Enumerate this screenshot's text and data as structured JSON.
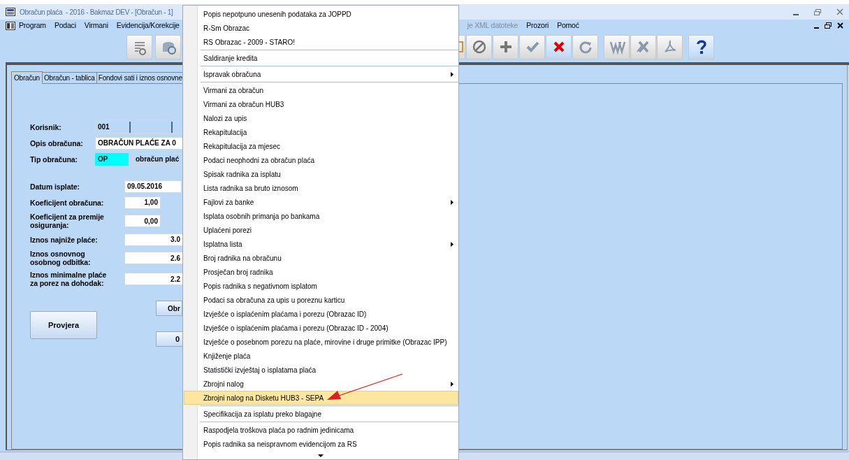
{
  "window": {
    "title": "Obračun plaća  - 2016 - Bakmaz DEV - [Obračun - 1]"
  },
  "menu_bar": [
    {
      "label": "Program",
      "disabled": false
    },
    {
      "label": "Podaci",
      "disabled": false
    },
    {
      "label": "Virmani",
      "disabled": false
    },
    {
      "label": "Evidencija/Korekcije",
      "disabled": false
    },
    {
      "label": "je XML datoteke",
      "disabled": true
    },
    {
      "label": "Prozori",
      "disabled": false
    },
    {
      "label": "Pomoć",
      "disabled": false
    }
  ],
  "tabs": [
    {
      "label": "Obračun",
      "selected": true
    },
    {
      "label": "Obračun - tablica",
      "selected": false
    },
    {
      "label": "Fondovi sati i iznos osnovne",
      "selected": false
    }
  ],
  "form": [
    {
      "label": "Korisnik:",
      "value": "001",
      "kind": "user"
    },
    {
      "label": "Opis obračuna:",
      "value": "OBRAČUN PLAĆE ZA 0",
      "kind": "wide"
    },
    {
      "label": "Tip obračuna:",
      "value": "OP",
      "extra": "obračun plać",
      "kind": "type"
    },
    {
      "label": "Datum isplate:",
      "value": "09.05.2016",
      "kind": "date"
    },
    {
      "label": "Koeficijent obračuna:",
      "value": "1,00",
      "kind": "small"
    },
    {
      "label": "Koeficijent za premije osiguranja:",
      "value": "0,00",
      "kind": "small"
    },
    {
      "label": "Iznos najniže plaće:",
      "value": "3.0",
      "kind": "amount"
    },
    {
      "label": "Iznos osnovnog osobnog odbitka:",
      "value": "2.6",
      "kind": "amount"
    },
    {
      "label": "Iznos minimalne plaće za porez na dohodak:",
      "value": "2.2",
      "kind": "amount"
    }
  ],
  "buttons": {
    "check": "Provjera",
    "calc": "Obr",
    "zero": "0"
  },
  "context_menu": [
    {
      "label": "Popis nepotpuno unesenih podataka za JOPPD",
      "submenu": false,
      "selected": false
    },
    {
      "label": "R-Sm Obrazac",
      "submenu": false,
      "selected": false
    },
    {
      "label": "RS Obrazac - 2009 - STARO!",
      "submenu": false,
      "selected": false,
      "separator_after": true
    },
    {
      "label": "Saldiranje kredita",
      "submenu": false,
      "selected": false,
      "separator_after": true
    },
    {
      "label": "Ispravak obračuna",
      "submenu": true,
      "selected": false,
      "separator_after": true
    },
    {
      "label": "Virmani za obračun",
      "submenu": false,
      "selected": false
    },
    {
      "label": "Virmani za obračun HUB3",
      "submenu": false,
      "selected": false
    },
    {
      "label": "Nalozi za upis",
      "submenu": false,
      "selected": false
    },
    {
      "label": "Rekapitulacija",
      "submenu": false,
      "selected": false
    },
    {
      "label": "Rekapitulacija za mjesec",
      "submenu": false,
      "selected": false
    },
    {
      "label": "Podaci neophodni za obračun plaća",
      "submenu": false,
      "selected": false
    },
    {
      "label": "Spisak radnika za isplatu",
      "submenu": false,
      "selected": false
    },
    {
      "label": "Lista radnika sa bruto iznosom",
      "submenu": false,
      "selected": false
    },
    {
      "label": "Fajlovi za banke",
      "submenu": true,
      "selected": false
    },
    {
      "label": "Isplata osobnih primanja po bankama",
      "submenu": false,
      "selected": false
    },
    {
      "label": "Uplaćeni porezi",
      "submenu": false,
      "selected": false
    },
    {
      "label": "Isplatna lista",
      "submenu": true,
      "selected": false
    },
    {
      "label": "Broj radnika na obračunu",
      "submenu": false,
      "selected": false
    },
    {
      "label": "Prosječan broj radnika",
      "submenu": false,
      "selected": false
    },
    {
      "label": "Popis radnika s negativnom isplatom",
      "submenu": false,
      "selected": false
    },
    {
      "label": "Podaci sa obračuna za upis u poreznu karticu",
      "submenu": false,
      "selected": false
    },
    {
      "label": "Izvješće o isplaćenim plaćama i porezu (Obrazac ID)",
      "submenu": false,
      "selected": false
    },
    {
      "label": "Izvješće o isplaćenim plaćama i porezu (Obrazac ID - 2004)",
      "submenu": false,
      "selected": false
    },
    {
      "label": "Izvješće o posebnom porezu na plaće, mirovine i druge primitke (Obrazac IPP)",
      "submenu": false,
      "selected": false
    },
    {
      "label": "Knjiženje plaća",
      "submenu": false,
      "selected": false
    },
    {
      "label": "Statistički izvještaj o isplatama plaća",
      "submenu": false,
      "selected": false
    },
    {
      "label": "Zbrojni nalog",
      "submenu": true,
      "selected": false
    },
    {
      "label": "Zbrojni nalog na Disketu HUB3 - SEPA",
      "submenu": false,
      "selected": true,
      "separator_after": true
    },
    {
      "label": "Specifikacija za isplatu preko blagajne",
      "submenu": false,
      "selected": false,
      "separator_after": true
    },
    {
      "label": "Raspodjela troškova plaća po radnim jedinicama",
      "submenu": false,
      "selected": false
    },
    {
      "label": "Popis radnika sa neispravnom evidencijom za RS",
      "submenu": false,
      "selected": false
    }
  ]
}
